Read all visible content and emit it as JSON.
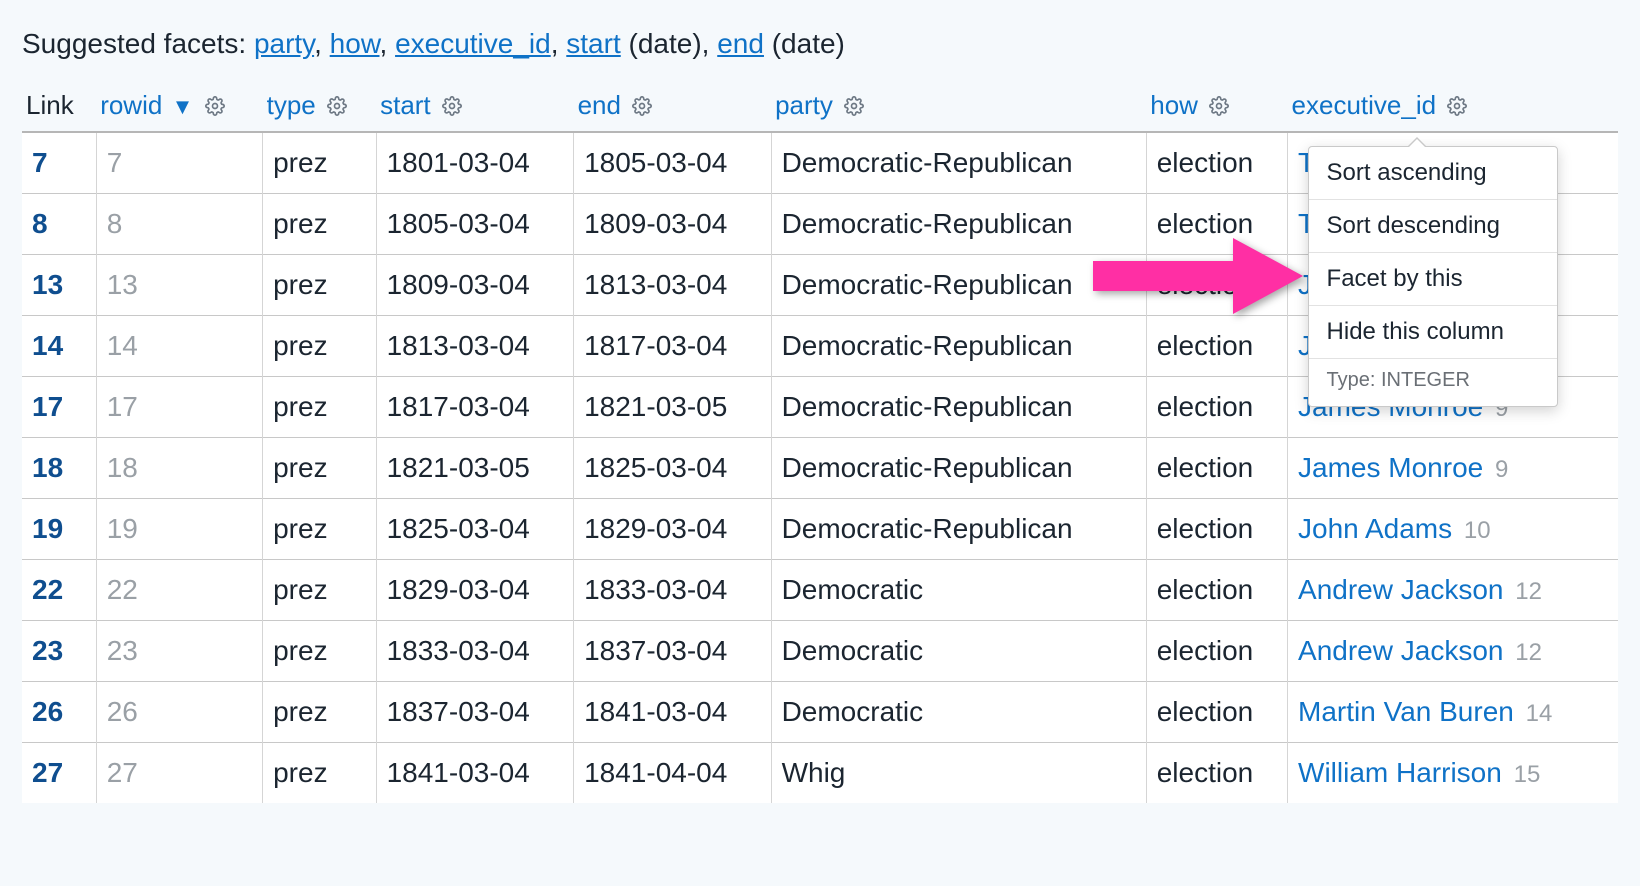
{
  "facets": {
    "prefix": "Suggested facets: ",
    "links": [
      {
        "label": "party",
        "suffix": ", "
      },
      {
        "label": "how",
        "suffix": ", "
      },
      {
        "label": "executive_id",
        "suffix": ", "
      },
      {
        "label": "start",
        "suffix": " (date), "
      },
      {
        "label": "end",
        "suffix": " (date)"
      }
    ]
  },
  "columns": {
    "link": "Link",
    "rowid": "rowid",
    "type": "type",
    "start": "start",
    "end": "end",
    "party": "party",
    "how": "how",
    "executive_id": "executive_id"
  },
  "sort_indicator": "▼",
  "rows": [
    {
      "link": "7",
      "rowid": "7",
      "type": "prez",
      "start": "1801-03-04",
      "end": "1805-03-04",
      "party": "Democratic-Republican",
      "how": "election",
      "exec_name": "T",
      "exec_num": ""
    },
    {
      "link": "8",
      "rowid": "8",
      "type": "prez",
      "start": "1805-03-04",
      "end": "1809-03-04",
      "party": "Democratic-Republican",
      "how": "election",
      "exec_name": "T",
      "exec_num": ""
    },
    {
      "link": "13",
      "rowid": "13",
      "type": "prez",
      "start": "1809-03-04",
      "end": "1813-03-04",
      "party": "Democratic-Republican",
      "how": "election",
      "exec_name": "J",
      "exec_num": ""
    },
    {
      "link": "14",
      "rowid": "14",
      "type": "prez",
      "start": "1813-03-04",
      "end": "1817-03-04",
      "party": "Democratic-Republican",
      "how": "election",
      "exec_name": "J",
      "exec_num": ""
    },
    {
      "link": "17",
      "rowid": "17",
      "type": "prez",
      "start": "1817-03-04",
      "end": "1821-03-05",
      "party": "Democratic-Republican",
      "how": "election",
      "exec_name": "James Monroe",
      "exec_num": "9"
    },
    {
      "link": "18",
      "rowid": "18",
      "type": "prez",
      "start": "1821-03-05",
      "end": "1825-03-04",
      "party": "Democratic-Republican",
      "how": "election",
      "exec_name": "James Monroe",
      "exec_num": "9"
    },
    {
      "link": "19",
      "rowid": "19",
      "type": "prez",
      "start": "1825-03-04",
      "end": "1829-03-04",
      "party": "Democratic-Republican",
      "how": "election",
      "exec_name": "John Adams",
      "exec_num": "10"
    },
    {
      "link": "22",
      "rowid": "22",
      "type": "prez",
      "start": "1829-03-04",
      "end": "1833-03-04",
      "party": "Democratic",
      "how": "election",
      "exec_name": "Andrew Jackson",
      "exec_num": "12"
    },
    {
      "link": "23",
      "rowid": "23",
      "type": "prez",
      "start": "1833-03-04",
      "end": "1837-03-04",
      "party": "Democratic",
      "how": "election",
      "exec_name": "Andrew Jackson",
      "exec_num": "12"
    },
    {
      "link": "26",
      "rowid": "26",
      "type": "prez",
      "start": "1837-03-04",
      "end": "1841-03-04",
      "party": "Democratic",
      "how": "election",
      "exec_name": "Martin Van Buren",
      "exec_num": "14"
    },
    {
      "link": "27",
      "rowid": "27",
      "type": "prez",
      "start": "1841-03-04",
      "end": "1841-04-04",
      "party": "Whig",
      "how": "election",
      "exec_name": "William Harrison",
      "exec_num": "15"
    }
  ],
  "dropdown": {
    "sort_asc": "Sort ascending",
    "sort_desc": "Sort descending",
    "facet": "Facet by this",
    "hide": "Hide this column",
    "type_label": "Type: INTEGER"
  }
}
